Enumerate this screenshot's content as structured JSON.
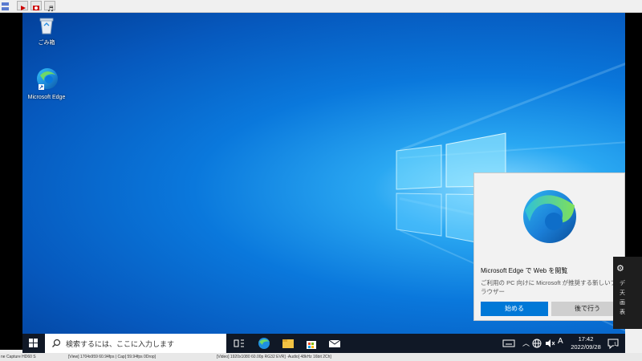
{
  "capture_toolbar": {
    "app_icon": "capture-app-icon",
    "buttons": [
      {
        "icon": "play-icon"
      },
      {
        "icon": "record-icon"
      },
      {
        "icon": "music-note-icon"
      }
    ]
  },
  "desktop": {
    "icons": [
      {
        "label": "ごみ箱",
        "icon": "recycle-bin-icon"
      },
      {
        "label": "Microsoft Edge",
        "icon": "edge-icon"
      }
    ]
  },
  "taskbar": {
    "search_placeholder": "検索するには、ここに入力します",
    "ime": "A",
    "time": "17:42",
    "date": "2022/09/28",
    "notification_count": "1"
  },
  "toast": {
    "title": "Microsoft Edge で Web を閲覧",
    "body": "ご利用の PC 向けに Microsoft が推奨する新しいブラウザー",
    "primary_button": "始める",
    "secondary_button": "後で行う"
  },
  "side_panel": {
    "label": "デ\n天\n画\n表"
  },
  "status_bar": {
    "left": "ne Capture HD60 S",
    "view": "[View] 1704x959 60.94fps | Cap[ 59.94fps 0Drop]",
    "video": "[Video] 1920x1080 60.00p RG32 EVR] ·Audio[ 48kHz 16bit 2Ch]"
  },
  "colors": {
    "desktop_blue": "#0a78dc",
    "taskbar": "#101826",
    "accent": "#0078d7"
  }
}
